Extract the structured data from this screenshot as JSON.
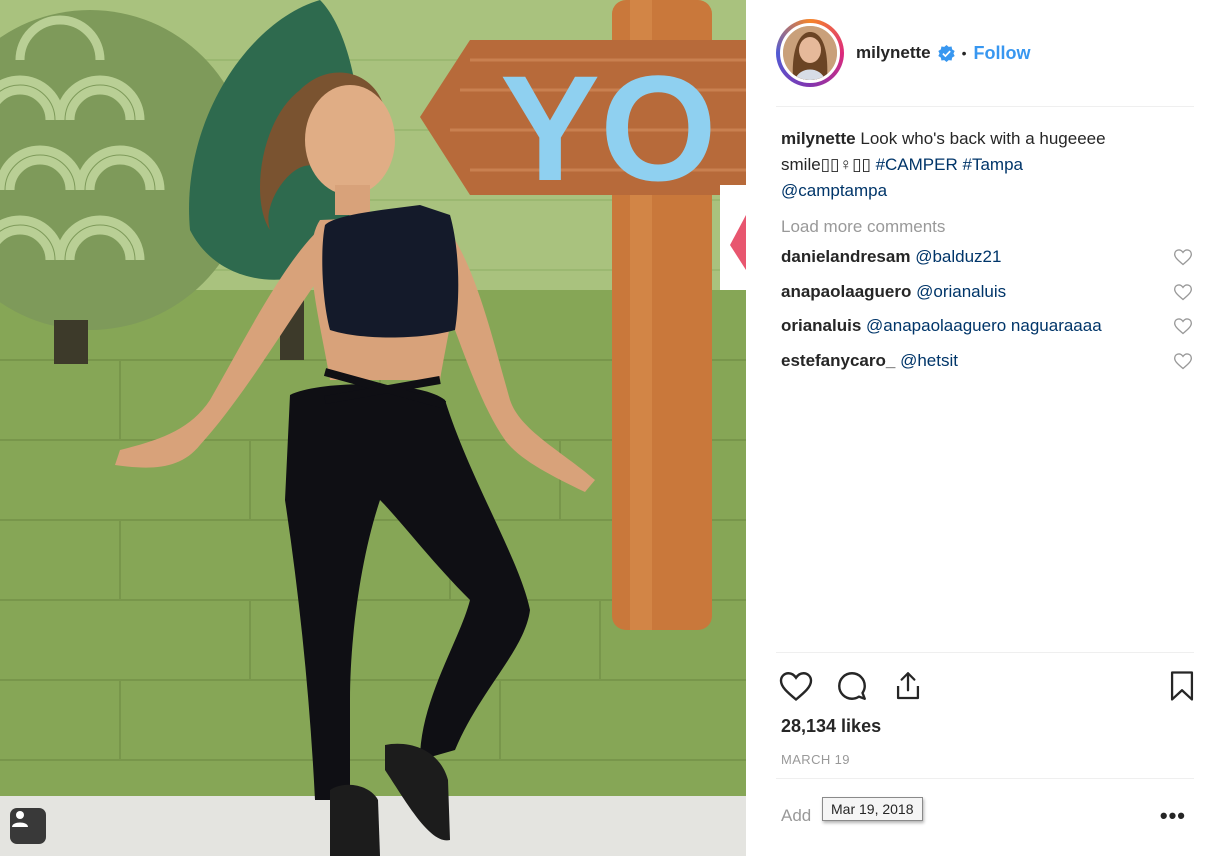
{
  "post": {
    "username": "milynette",
    "follow_label": "Follow",
    "dot": "•",
    "caption": {
      "username": "milynette",
      "text": "Look who's back with a hugeeee smile▯▯♀▯▯",
      "hashtags": [
        "#CAMPER",
        "#Tampa"
      ],
      "mention": "@camptampa"
    },
    "load_more": "Load more comments",
    "comments": [
      {
        "user": "danielandresam",
        "text": "@balduz21"
      },
      {
        "user": "anapaolaaguero",
        "text": "@orianaluis"
      },
      {
        "user": "orianaluis",
        "text": "@anapaolaaguero naguaraaaa"
      },
      {
        "user": "estefanycaro_",
        "text": "@hetsit"
      }
    ],
    "likes": "28,134 likes",
    "date": "MARCH 19",
    "add_comment_placeholder": "Add",
    "date_tooltip": "Mar 19, 2018",
    "more_label": "•••"
  },
  "photo": {
    "sign_text": "YO"
  },
  "icons": {
    "verified": "verified-badge-icon",
    "like": "heart-icon",
    "comment": "comment-bubble-icon",
    "share": "share-icon",
    "save": "bookmark-icon",
    "tag": "user-tag-icon"
  },
  "colors": {
    "link_blue": "#3897f0",
    "hashtag": "#003569",
    "muted": "#999999",
    "wall_green": "#8fae62"
  }
}
